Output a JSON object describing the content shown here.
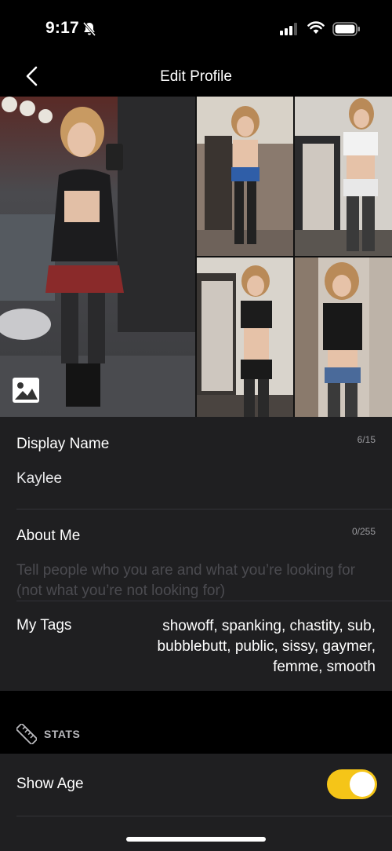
{
  "status_bar": {
    "time": "9:17"
  },
  "nav": {
    "title": "Edit Profile"
  },
  "profile": {
    "display_name": {
      "label": "Display Name",
      "value": "Kaylee",
      "counter": "6/15"
    },
    "about_me": {
      "label": "About Me",
      "counter": "0/255",
      "placeholder": "Tell people who you are and what you’re looking for (not what you’re not looking for)"
    },
    "tags": {
      "label": "My Tags",
      "value": "showoff, spanking, chastity, sub, bubblebutt, public, sissy, gaymer, femme, smooth"
    }
  },
  "stats": {
    "section_label": "STATS",
    "show_age": {
      "label": "Show Age",
      "enabled": true
    }
  },
  "colors": {
    "accent": "#f5c518",
    "panel": "#1f1f21",
    "background": "#000000"
  }
}
